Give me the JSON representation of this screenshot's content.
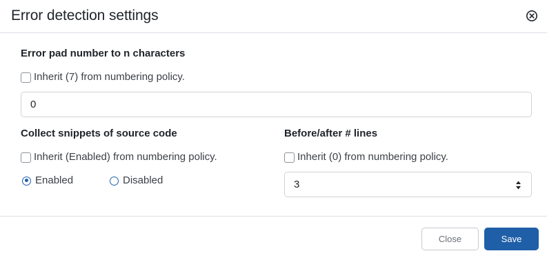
{
  "dialog": {
    "title": "Error detection settings",
    "close_icon": "circle-x-icon"
  },
  "pad_section": {
    "label": "Error pad number to n characters",
    "inherit_label": "Inherit (7) from numbering policy.",
    "inherit_checked": false,
    "value": "0"
  },
  "snippets_section": {
    "label": "Collect snippets of source code",
    "inherit_label": "Inherit (Enabled) from numbering policy.",
    "inherit_checked": false,
    "options": [
      {
        "label": "Enabled",
        "checked": true
      },
      {
        "label": "Disabled",
        "checked": false
      }
    ]
  },
  "lines_section": {
    "label": "Before/after # lines",
    "inherit_label": "Inherit (0) from numbering policy.",
    "inherit_checked": false,
    "value": "3"
  },
  "footer": {
    "close_label": "Close",
    "save_label": "Save"
  },
  "colors": {
    "accent": "#1f5fa8",
    "border": "#cfd3d8",
    "divider": "#dcdfe4"
  }
}
